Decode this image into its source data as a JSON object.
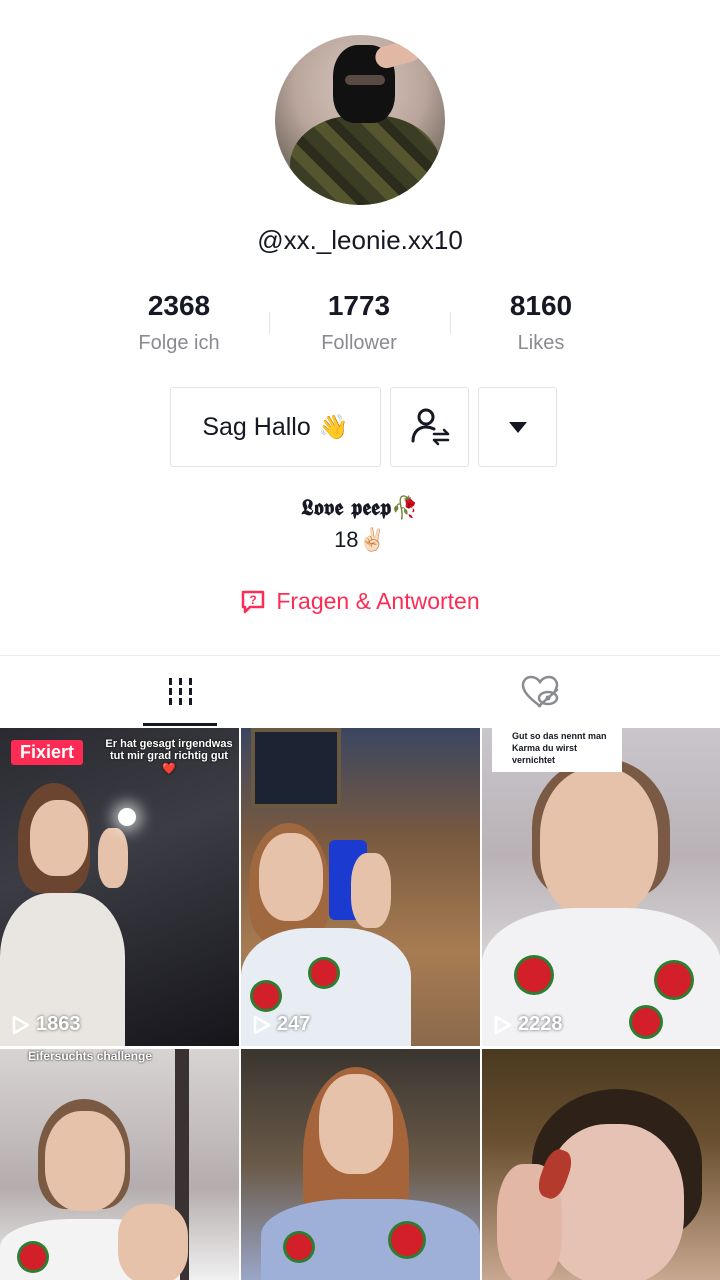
{
  "profile": {
    "username": "@xx._leonie.xx10",
    "avatar_alt": "profile photo"
  },
  "stats": [
    {
      "value": "2368",
      "label": "Folge ich"
    },
    {
      "value": "1773",
      "label": "Follower"
    },
    {
      "value": "8160",
      "label": "Likes"
    }
  ],
  "actions": {
    "hallo_label": "Sag Hallo",
    "hallo_emoji": "👋",
    "follow_icon": "person-swap-icon",
    "more_icon": "dropdown-triangle-icon"
  },
  "bio": {
    "line1": "𝕷𝖔𝖛𝖊 𝖕𝖊𝖊𝖕🥀",
    "line2": "18✌🏻"
  },
  "qa": {
    "label": "Fragen & Antworten",
    "icon": "question-box-icon"
  },
  "tabs": [
    {
      "icon": "videos-grid-icon",
      "active": true
    },
    {
      "icon": "liked-hidden-icon",
      "active": false
    }
  ],
  "videos": [
    {
      "views": "1863",
      "pinned_label": "Fixiert",
      "overlay": "Er hat gesagt irgendwas tut mir grad richtig gut ❤️"
    },
    {
      "views": "247"
    },
    {
      "views": "2228",
      "overlay": "Gut so das nennt man Karma du wirst vernichtet"
    },
    {
      "overlay": "Eifersuchts challenge"
    },
    {},
    {}
  ],
  "colors": {
    "accent": "#fe2c55",
    "text": "#161823",
    "muted": "#8a8b91",
    "border": "#e3e3e4"
  }
}
